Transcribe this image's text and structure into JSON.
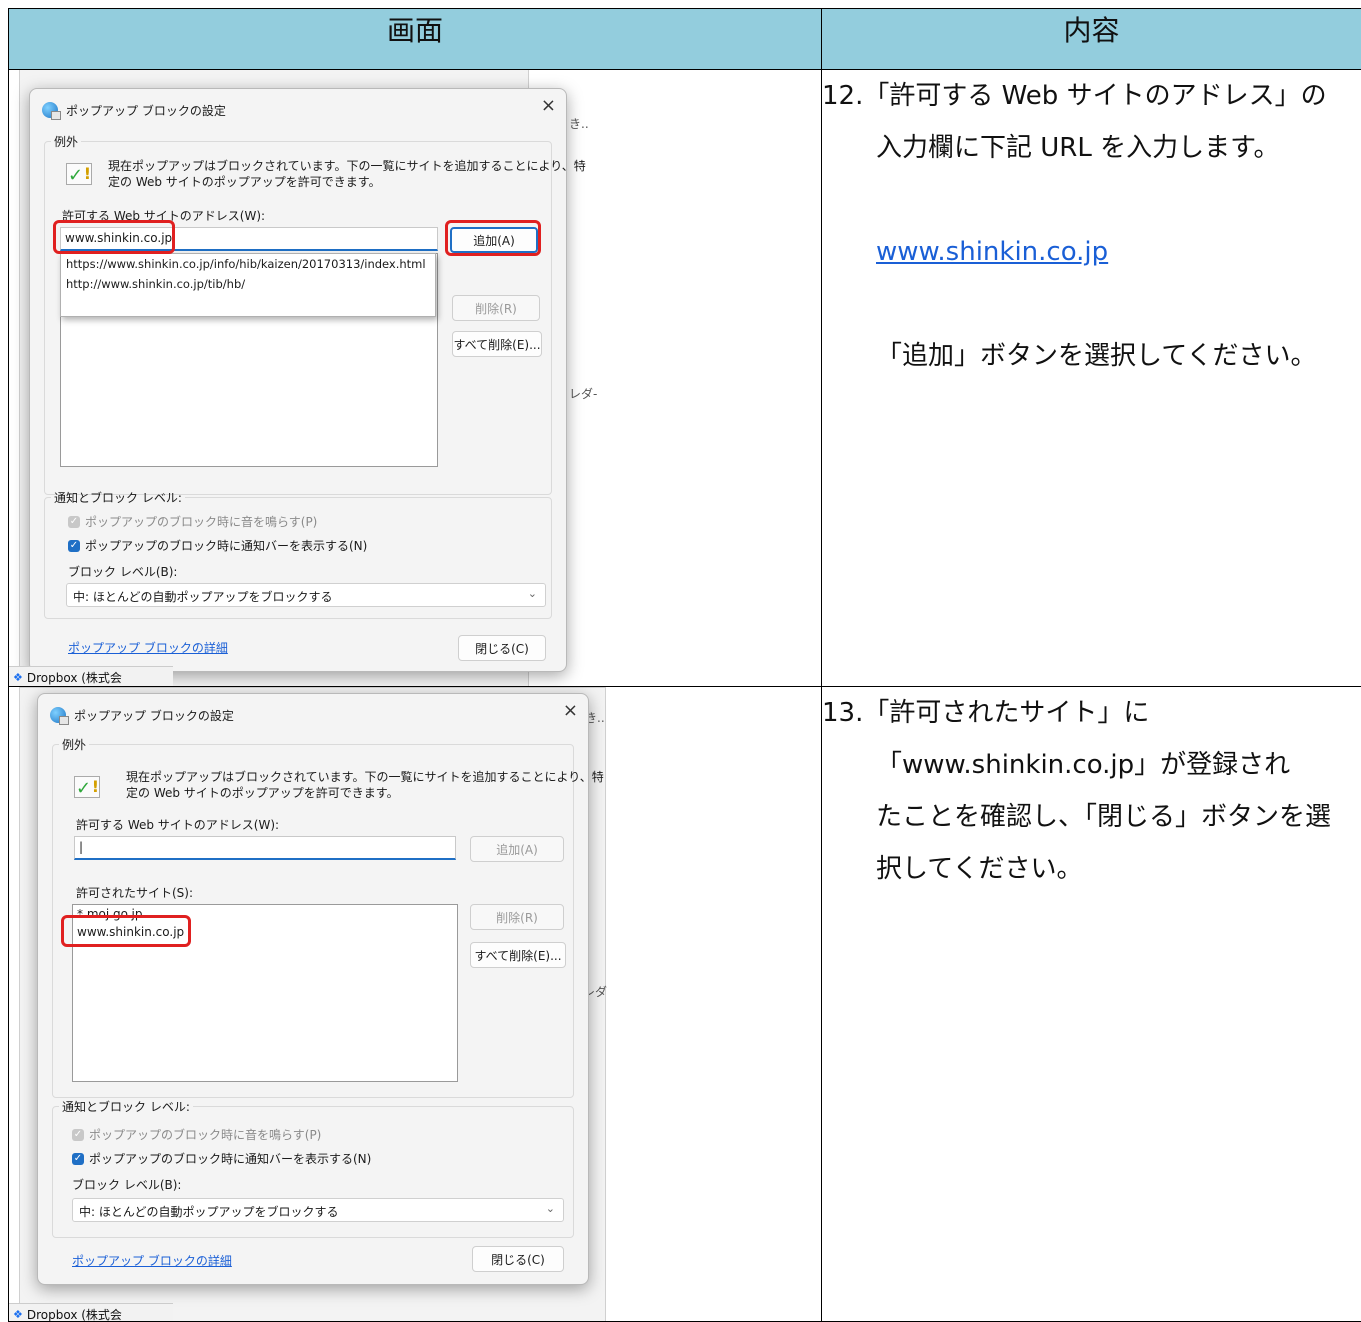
{
  "header": {
    "col1": "画面",
    "col2": "内容"
  },
  "step12": {
    "line1": "12.「許可する Web サイトのアドレス」の",
    "line2": "入力欄に下記 URL を入力します。",
    "url": "www.shinkin.co.jp",
    "line3": "「追加」ボタンを選択してください。"
  },
  "step13": {
    "line1": "13.「許可されたサイト」に",
    "line2": "「www.shinkin.co.jp」が登録され",
    "line3": "たことを確認し、「閉じる」ボタンを選",
    "line4": "択してください。"
  },
  "dialog1": {
    "title": "ポップアップ ブロックの設定",
    "close": "×",
    "group_exceptions": "例外",
    "info_text_1": "現在ポップアップはブロックされています。下の一覧にサイトを追加することにより、特",
    "info_text_2": "定の Web サイトのポップアップを許可できます。",
    "address_label": "許可する Web サイトのアドレス(W):",
    "address_value": "www.shinkin.co.jp",
    "add_button": "追加(A)",
    "autocomplete": [
      "https://www.shinkin.co.jp/info/hib/kaizen/20170313/index.html",
      "http://www.shinkin.co.jp/tib/hb/"
    ],
    "remove_button": "削除(R)",
    "remove_all_button": "すべて削除(E)...",
    "group_notify": "通知とブロック レベル:",
    "check_sound": "ポップアップのブロック時に音を鳴らす(P)",
    "check_bar": "ポップアップのブロック時に通知バーを表示する(N)",
    "block_level_label": "ブロック レベル(B):",
    "block_level_value": "中: ほとんどの自動ポップアップをブロックする",
    "details_link": "ポップアップ ブロックの詳細",
    "close_button": "閉じる(C)",
    "taskbar": "Dropbox (株式会"
  },
  "dialog2": {
    "title": "ポップアップ ブロックの設定",
    "close": "×",
    "group_exceptions": "例外",
    "info_text_1": "現在ポップアップはブロックされています。下の一覧にサイトを追加することにより、特",
    "info_text_2": "定の Web サイトのポップアップを許可できます。",
    "address_label": "許可する Web サイトのアドレス(W):",
    "address_value": "|",
    "add_button": "追加(A)",
    "allowed_label": "許可されたサイト(S):",
    "allowed_sites": [
      "*.moj.go.jp",
      "www.shinkin.co.jp"
    ],
    "remove_button": "削除(R)",
    "remove_all_button": "すべて削除(E)...",
    "group_notify": "通知とブロック レベル:",
    "check_sound": "ポップアップのブロック時に音を鳴らす(P)",
    "check_bar": "ポップアップのブロック時に通知バーを表示する(N)",
    "block_level_label": "ブロック レベル(B):",
    "block_level_value": "中: ほとんどの自動ポップアップをブロックする",
    "details_link": "ポップアップ ブロックの詳細",
    "close_button": "閉じる(C)",
    "taskbar": "Dropbox (株式会"
  },
  "colors": {
    "header_bg": "#93cddd",
    "highlight": "#e02020",
    "accent": "#1f6fc5"
  }
}
